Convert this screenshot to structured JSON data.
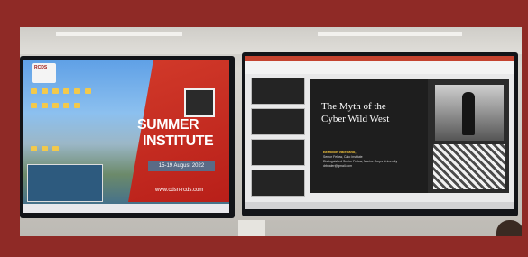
{
  "left_screen": {
    "logo_text": "RCDS",
    "event_line1": "SUMMER",
    "event_line2": "INSTITUTE",
    "dates": "15-19 August 2022",
    "url": "www.cdsn-rcds.com"
  },
  "right_screen": {
    "slide_title_line1": "The Myth of the",
    "slide_title_line2": "Cyber Wild West",
    "author": "Brandon Valeriano,",
    "affiliation_line1": "Senior Fellow, Cato Institute",
    "affiliation_line2": "Distinguished Senior Fellow, Marine Corps University",
    "email": "drbvaler@gmail.com"
  },
  "colors": {
    "frame": "#8f2a26",
    "accent_red": "#c8281e",
    "slide_bg": "#2b2b2b"
  }
}
